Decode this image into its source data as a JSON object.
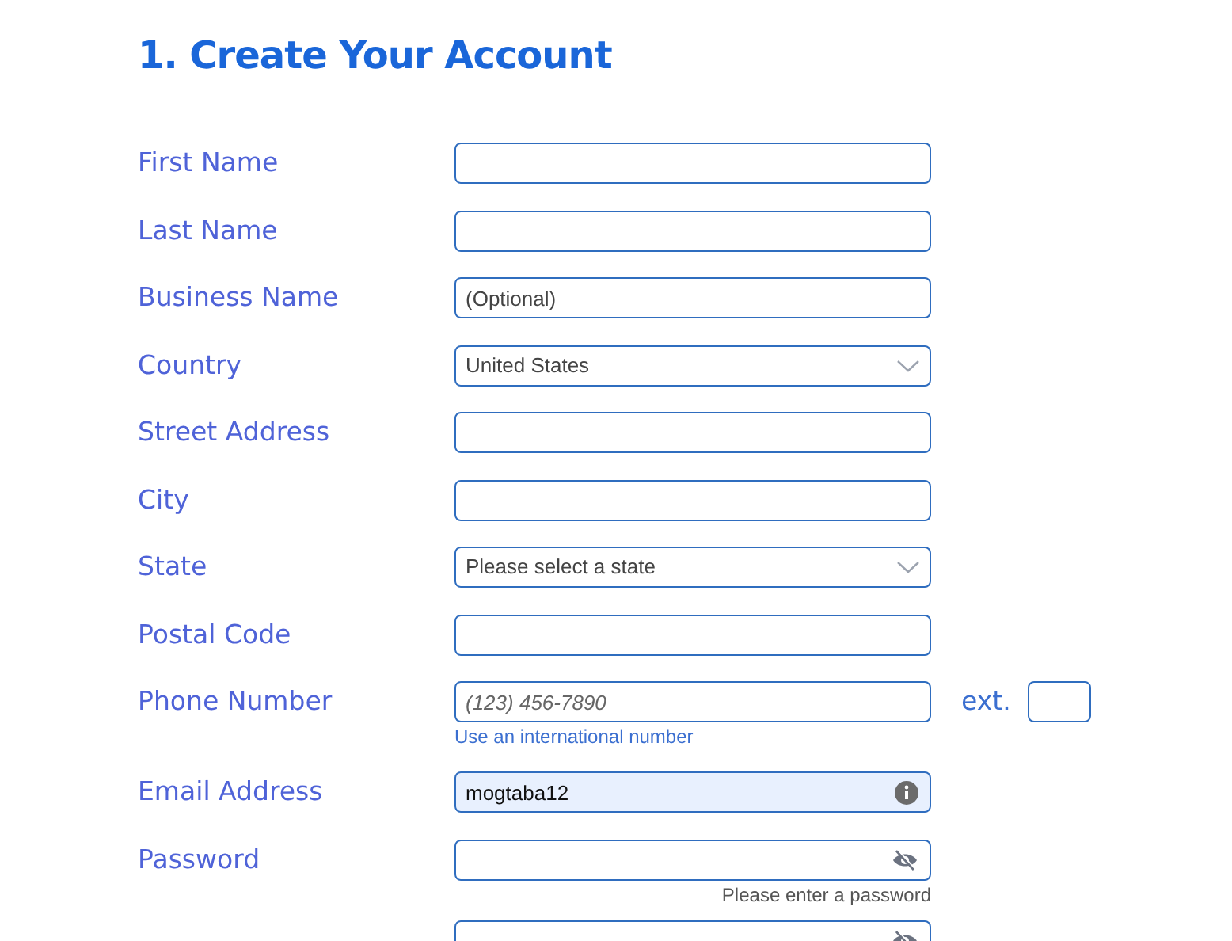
{
  "heading": "1. Create Your Account",
  "fields": [
    {
      "kind": "text",
      "label": "First Name"
    },
    {
      "kind": "text",
      "label": "Last Name"
    },
    {
      "kind": "text",
      "label": "Business Name",
      "placeholder": "(Optional)"
    },
    {
      "kind": "select",
      "label": "Country",
      "value": "United States"
    },
    {
      "kind": "text",
      "label": "Street Address"
    },
    {
      "kind": "text",
      "label": "City"
    },
    {
      "kind": "select",
      "label": "State",
      "value": "Please select a state"
    },
    {
      "kind": "text",
      "label": "Postal Code"
    },
    {
      "kind": "phone",
      "label": "Phone Number",
      "placeholder": "(123) 456-7890",
      "ext_label": "ext.",
      "hint": "Use an international number"
    },
    {
      "kind": "email",
      "label": "Email Address",
      "value": "mogtaba12"
    },
    {
      "kind": "password",
      "label": "Password",
      "hint": "Please enter a password"
    },
    {
      "kind": "password"
    }
  ]
}
